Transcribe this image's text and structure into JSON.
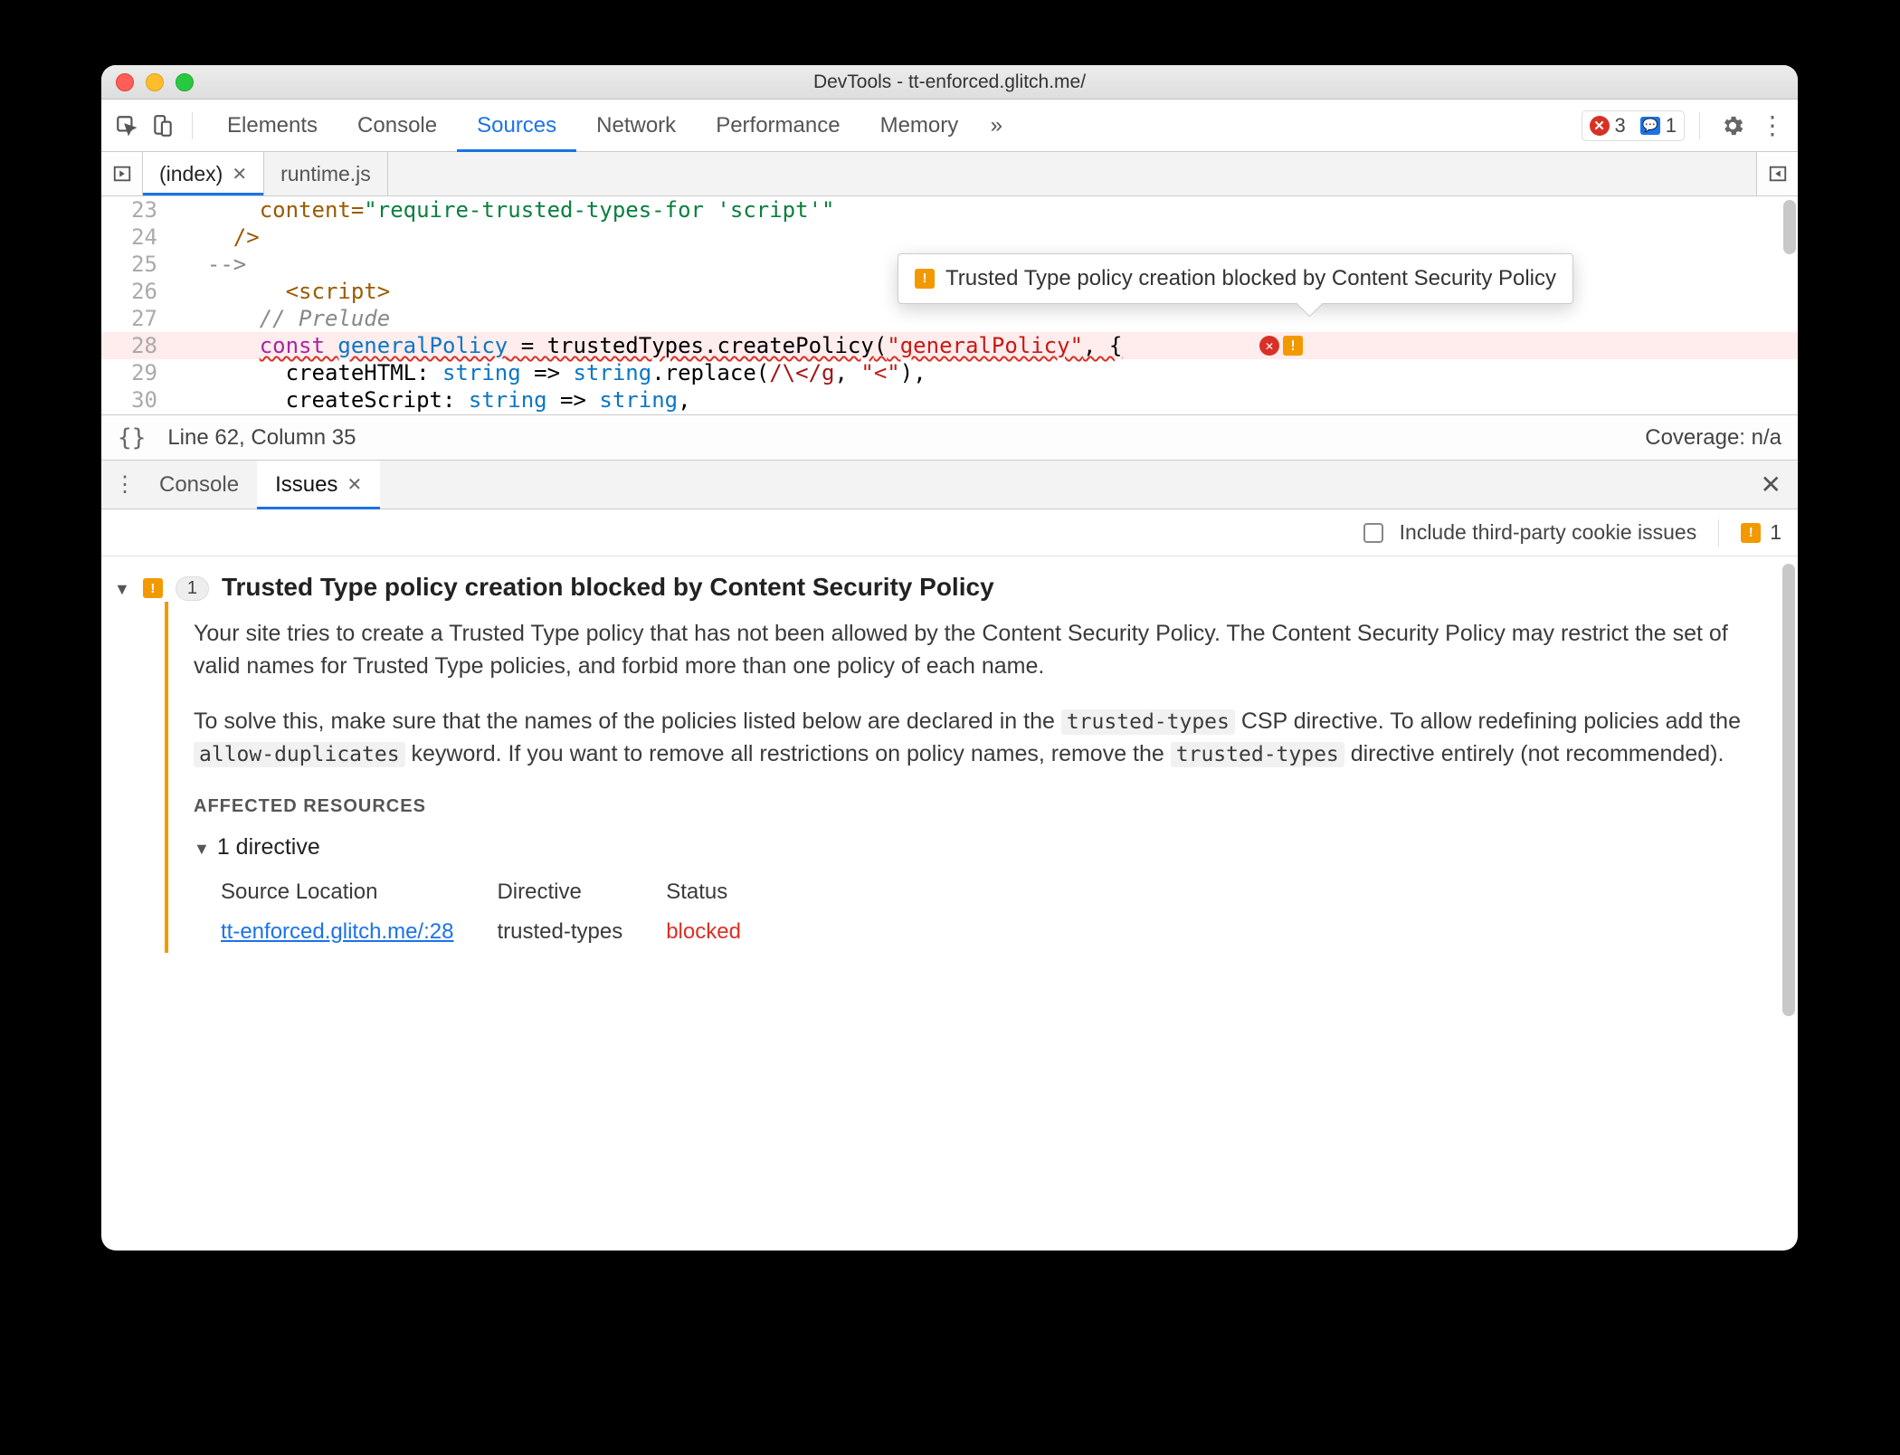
{
  "window": {
    "title": "DevTools - tt-enforced.glitch.me/"
  },
  "toolbar": {
    "tabs": [
      "Elements",
      "Console",
      "Sources",
      "Network",
      "Performance",
      "Memory"
    ],
    "active_tab": "Sources",
    "more": "»",
    "errors_count": "3",
    "messages_count": "1"
  },
  "file_tabs": {
    "items": [
      {
        "label": "(index)",
        "active": true
      },
      {
        "label": "runtime.js",
        "active": false
      }
    ]
  },
  "source": {
    "lines": [
      {
        "n": "23",
        "indent": 3,
        "tokens": [
          {
            "t": "content=",
            "c": "c-brown"
          },
          {
            "t": "\"require-trusted-types-for 'script'\"",
            "c": "c-green"
          }
        ]
      },
      {
        "n": "24",
        "indent": 2,
        "tokens": [
          {
            "t": "/>",
            "c": "c-brown"
          }
        ]
      },
      {
        "n": "25",
        "indent": 1,
        "tokens": [
          {
            "t": "-->",
            "c": "c-gray"
          }
        ]
      },
      {
        "n": "26",
        "indent": 4,
        "tokens": [
          {
            "t": "<script>",
            "c": "c-brown"
          }
        ]
      },
      {
        "n": "27",
        "indent": 3,
        "tokens": [
          {
            "t": "// Prelude",
            "c": "c-gray",
            "i": true
          }
        ]
      },
      {
        "n": "28",
        "indent": 3,
        "hl": true,
        "squiggle": true,
        "tokens": [
          {
            "t": "const ",
            "c": "c-purple"
          },
          {
            "t": "generalPolicy",
            "c": "c-blue"
          },
          {
            "t": " = trustedTypes.",
            "c": ""
          },
          {
            "t": "createPolicy",
            "c": ""
          },
          {
            "t": "(",
            "c": ""
          },
          {
            "t": "\"generalPolicy\"",
            "c": "c-str"
          },
          {
            "t": ", {",
            "c": ""
          }
        ]
      },
      {
        "n": "29",
        "indent": 4,
        "tokens": [
          {
            "t": "createHTML: ",
            "c": ""
          },
          {
            "t": "string",
            "c": "c-blue"
          },
          {
            "t": " => ",
            "c": ""
          },
          {
            "t": "string",
            "c": "c-blue"
          },
          {
            "t": ".replace(",
            "c": ""
          },
          {
            "t": "/\\</g",
            "c": "c-dkred"
          },
          {
            "t": ", ",
            "c": ""
          },
          {
            "t": "\"&lt;\"",
            "c": "c-str"
          },
          {
            "t": "),",
            "c": ""
          }
        ]
      },
      {
        "n": "30",
        "indent": 4,
        "tokens": [
          {
            "t": "createScript: ",
            "c": ""
          },
          {
            "t": "string",
            "c": "c-blue"
          },
          {
            "t": " => ",
            "c": ""
          },
          {
            "t": "string",
            "c": "c-blue"
          },
          {
            "t": ",",
            "c": ""
          }
        ]
      }
    ],
    "tooltip": "Trusted Type policy creation blocked by Content Security Policy"
  },
  "statusbar": {
    "braces": "{}",
    "pos": "Line 62, Column 35",
    "coverage": "Coverage: n/a"
  },
  "drawer": {
    "tabs": [
      {
        "label": "Console",
        "active": false
      },
      {
        "label": "Issues",
        "active": true
      }
    ]
  },
  "filter": {
    "checkbox_label": "Include third-party cookie issues",
    "badge_count": "1"
  },
  "issue": {
    "count": "1",
    "title": "Trusted Type policy creation blocked by Content Security Policy",
    "para1": "Your site tries to create a Trusted Type policy that has not been allowed by the Content Security Policy. The Content Security Policy may restrict the set of valid names for Trusted Type policies, and forbid more than one policy of each name.",
    "para2_a": "To solve this, make sure that the names of the policies listed below are declared in the ",
    "code1": "trusted-types",
    "para2_b": " CSP directive. To allow redefining policies add the ",
    "code2": "allow-duplicates",
    "para2_c": " keyword. If you want to remove all restrictions on policy names, remove the ",
    "code3": "trusted-types",
    "para2_d": " directive entirely (not recommended).",
    "affected_heading": "AFFECTED RESOURCES",
    "sub_count": "1 directive",
    "table": {
      "headers": [
        "Source Location",
        "Directive",
        "Status"
      ],
      "row": {
        "source": "tt-enforced.glitch.me/:28",
        "directive": "trusted-types",
        "status": "blocked"
      }
    }
  }
}
